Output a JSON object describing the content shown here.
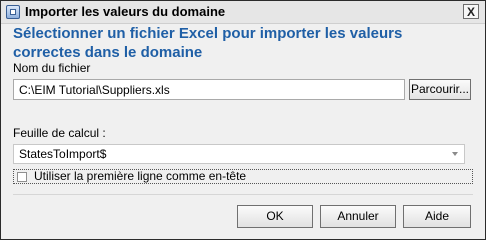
{
  "window": {
    "title": "Importer les valeurs du domaine",
    "close_label": "X"
  },
  "heading": "Sélectionner un fichier Excel pour importer les valeurs correctes dans le domaine",
  "file": {
    "label": "Nom du fichier",
    "value": "C:\\EIM Tutorial\\Suppliers.xls",
    "browse_label": "Parcourir..."
  },
  "sheet": {
    "label": "Feuille de calcul :",
    "selected": "StatesToImport$"
  },
  "header_option": {
    "label": "Utiliser la première ligne comme en-tête",
    "checked": false
  },
  "buttons": {
    "ok": "OK",
    "cancel": "Annuler",
    "help": "Aide"
  }
}
